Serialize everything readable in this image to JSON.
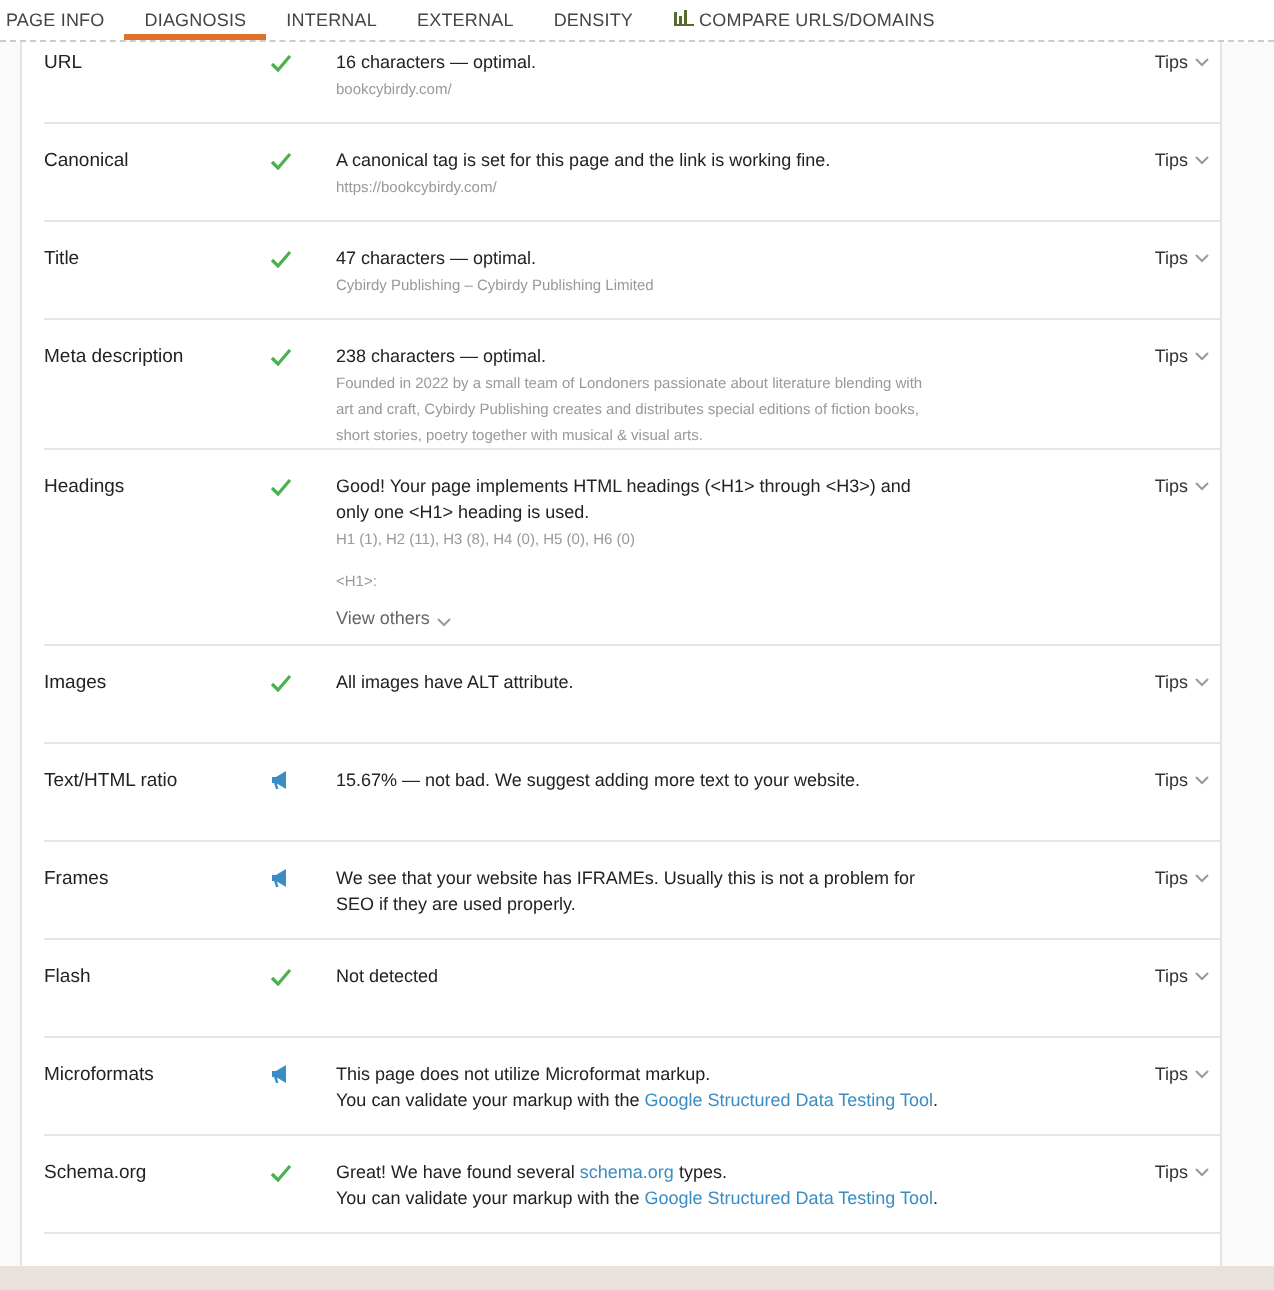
{
  "tabs": [
    {
      "label": "PAGE INFO",
      "selected": false
    },
    {
      "label": "DIAGNOSIS",
      "selected": true
    },
    {
      "label": "INTERNAL",
      "selected": false
    },
    {
      "label": "EXTERNAL",
      "selected": false
    },
    {
      "label": "DENSITY",
      "selected": false
    },
    {
      "label": "COMPARE URLS/DOMAINS",
      "selected": false,
      "kind": "chart"
    }
  ],
  "checks": [
    {
      "label": "URL",
      "kind": "pass",
      "message": [
        [
          {
            "text": "16 characters — optimal."
          }
        ]
      ],
      "details": [
        "bookcybirdy.com/"
      ],
      "tips": "Tips"
    },
    {
      "label": "Canonical",
      "kind": "pass",
      "message": [
        [
          {
            "text": "A canonical tag is set for this page and the link is working fine."
          }
        ]
      ],
      "details": [
        "https://bookcybirdy.com/"
      ],
      "tips": "Tips"
    },
    {
      "label": "Title",
      "kind": "pass",
      "message": [
        [
          {
            "text": "47 characters — optimal."
          }
        ]
      ],
      "details": [
        "Cybirdy Publishing – Cybirdy Publishing Limited"
      ],
      "tips": "Tips"
    },
    {
      "label": "Meta description",
      "kind": "pass",
      "message": [
        [
          {
            "text": "238 characters — optimal."
          }
        ]
      ],
      "details": [
        "Founded in 2022 by a small team of Londoners passionate about literature blending with art and craft, Cybirdy Publishing creates and distributes special editions of fiction books, short stories, poetry together with musical & visual arts."
      ],
      "tips": "Tips"
    },
    {
      "label": "Headings",
      "kind": "pass",
      "message": [
        [
          {
            "text": "Good! Your page implements HTML headings (<H1> through <H3>) and only one <H1> heading is used."
          }
        ]
      ],
      "details": [
        "H1 (1), H2 (11), H3 (8), H4 (0), H5 (0), H6 (0)",
        "<H1>:"
      ],
      "more": "View others",
      "tips": "Tips"
    },
    {
      "label": "Images",
      "kind": "pass",
      "message": [
        [
          {
            "text": "All images have ALT attribute."
          }
        ]
      ],
      "tips": "Tips"
    },
    {
      "label": "Text/HTML ratio",
      "kind": "notice",
      "message": [
        [
          {
            "text": "15.67% — not bad. We suggest adding more text to your website."
          }
        ]
      ],
      "tips": "Tips"
    },
    {
      "label": "Frames",
      "kind": "notice",
      "message": [
        [
          {
            "text": "We see that your website has IFRAMEs. Usually this is not a problem for SEO if they are used properly."
          }
        ]
      ],
      "tips": "Tips"
    },
    {
      "label": "Flash",
      "kind": "pass",
      "message": [
        [
          {
            "text": "Not detected"
          }
        ]
      ],
      "tips": "Tips"
    },
    {
      "label": "Microformats",
      "kind": "notice",
      "message": [
        [
          {
            "text": "This page does not utilize Microformat markup."
          }
        ],
        [
          {
            "text": "You can validate your markup with the "
          },
          {
            "text": "Google Structured Data Testing Tool",
            "link": true
          },
          {
            "text": "."
          }
        ]
      ],
      "tips": "Tips"
    },
    {
      "label": "Schema.org",
      "kind": "pass",
      "message": [
        [
          {
            "text": "Great! We have found several "
          },
          {
            "text": "schema.org",
            "link": true
          },
          {
            "text": " types."
          }
        ],
        [
          {
            "text": "You can validate your markup with the "
          },
          {
            "text": "Google Structured Data Testing Tool",
            "link": true
          },
          {
            "text": "."
          }
        ]
      ],
      "tips": "Tips"
    }
  ]
}
